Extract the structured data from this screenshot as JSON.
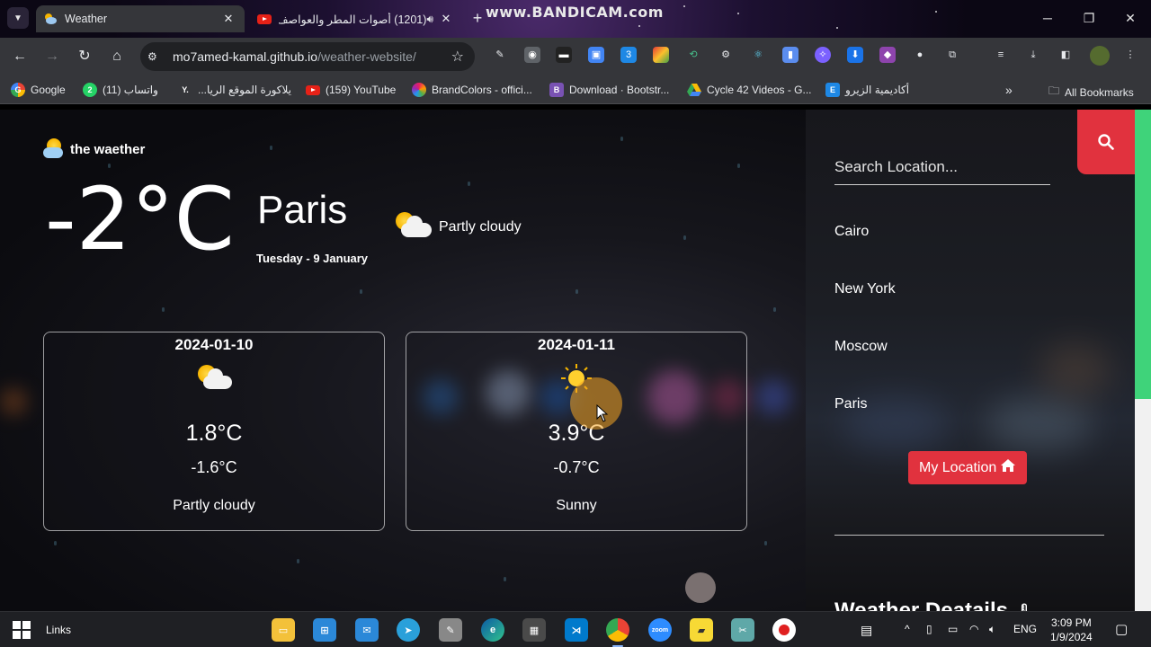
{
  "browser": {
    "tabs": [
      {
        "title": "Weather",
        "icon": "weather-favicon",
        "active": true
      },
      {
        "title": "(1201) أصوات المطر والعواصف",
        "icon": "youtube-favicon",
        "active": false
      }
    ],
    "watermark": "www.BANDICAM.com",
    "url_host": "mo7amed-kamal.github.io",
    "url_path": "/weather-website/",
    "bookmarks": [
      "Google",
      "(11) واتساب",
      "يلاكورة الموقع الريا...",
      "(159) YouTube",
      "BrandColors - offici...",
      "Download · Bootstr...",
      "Cycle 42 Videos - G...",
      "أكاديمية الزيرو"
    ],
    "all_bookmarks": "All Bookmarks"
  },
  "weather": {
    "brand": "the waether",
    "current_temp": "-2°C",
    "city": "Paris",
    "date": "Tuesday - 9 January",
    "condition": "Partly cloudy",
    "forecast": [
      {
        "date": "2024-01-10",
        "max": "1.8°C",
        "min": "-1.6°C",
        "condition": "Partly cloudy",
        "icon": "partly-cloudy-icon"
      },
      {
        "date": "2024-01-11",
        "max": "3.9°C",
        "min": "-0.7°C",
        "condition": "Sunny",
        "icon": "sunny-icon"
      }
    ]
  },
  "sidebar": {
    "search_placeholder": "Search Location...",
    "locations": [
      "Cairo",
      "New York",
      "Moscow",
      "Paris"
    ],
    "my_location": "My Location",
    "details_title": "Weather Deatails"
  },
  "taskbar": {
    "links": "Links",
    "language": "ENG",
    "time": "3:09 PM",
    "date": "1/9/2024"
  },
  "colors": {
    "accent_red": "#e1323e",
    "scroll_green": "#3fd37a",
    "chrome_toolbar": "#35363a"
  }
}
